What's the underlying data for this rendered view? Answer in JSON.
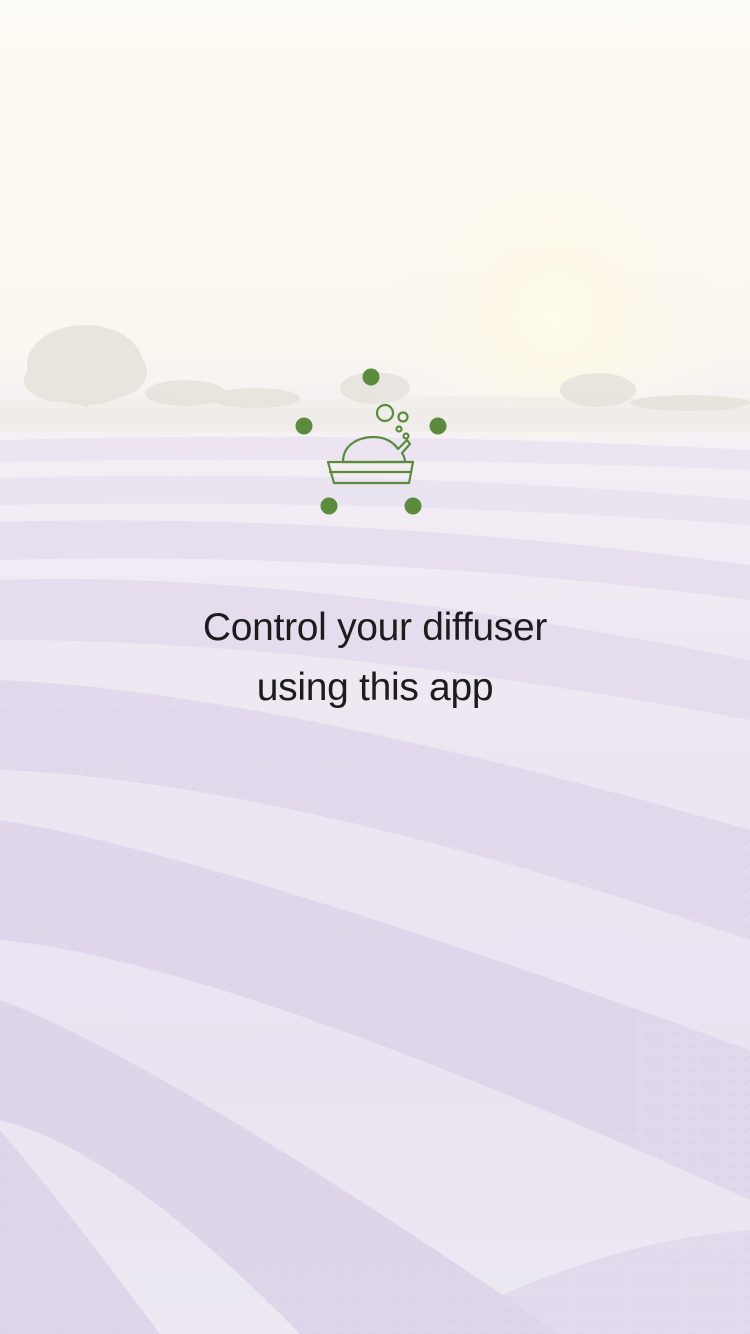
{
  "splash": {
    "tagline_line1": "Control your diffuser",
    "tagline_line2": "using this app"
  },
  "logo": {
    "icon": "diffuser-icon",
    "accent_color": "#5b8c3e"
  },
  "background": {
    "scene": "lavender-field-sunrise"
  }
}
